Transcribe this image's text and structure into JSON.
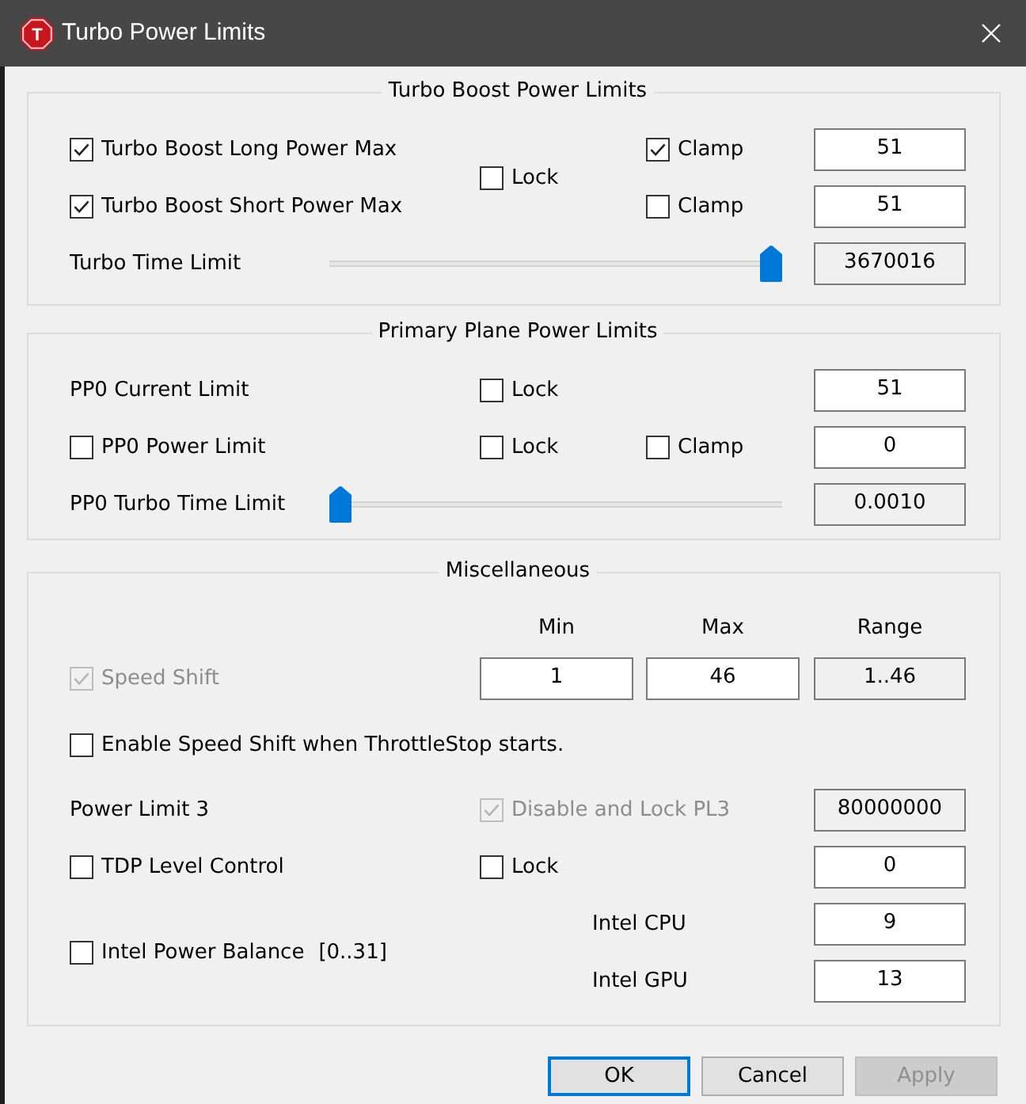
{
  "window": {
    "title": "Turbo Power Limits",
    "icon_label": "T"
  },
  "groups": [
    {
      "title": "Turbo Boost Power Limits",
      "rows": [
        {
          "kind": "pair",
          "lock": {
            "label": "Lock",
            "checked": false,
            "disabled": false
          },
          "lines": [
            {
              "check": {
                "label": "Turbo Boost Long Power Max",
                "checked": true,
                "disabled": false
              },
              "clamp": {
                "label": "Clamp",
                "checked": true,
                "disabled": false
              },
              "field": {
                "value": "51",
                "readonly": false
              }
            },
            {
              "check": {
                "label": "Turbo Boost Short Power Max",
                "checked": true,
                "disabled": false
              },
              "clamp": {
                "label": "Clamp",
                "checked": false,
                "disabled": false
              },
              "field": {
                "value": "51",
                "readonly": false
              }
            }
          ]
        },
        {
          "kind": "slider",
          "label": "Turbo Time Limit",
          "level": 1,
          "field": {
            "value": "3670016",
            "readonly": true
          }
        }
      ]
    },
    {
      "title": "Primary Plane Power Limits",
      "rows": [
        {
          "kind": "row",
          "label": "PP0 Current Limit",
          "lock": {
            "label": "Lock",
            "checked": false,
            "disabled": false
          },
          "field": {
            "value": "51",
            "readonly": false
          }
        },
        {
          "kind": "row",
          "check": {
            "label": "PP0 Power Limit",
            "checked": false,
            "disabled": false
          },
          "lock": {
            "label": "Lock",
            "checked": false,
            "disabled": false
          },
          "clamp": {
            "label": "Clamp",
            "checked": false,
            "disabled": false
          },
          "field": {
            "value": "0",
            "readonly": false
          }
        },
        {
          "kind": "slider",
          "label": "PP0 Turbo Time Limit",
          "level": 0,
          "field": {
            "value": "0.0010",
            "readonly": true
          }
        }
      ]
    },
    {
      "title": "Miscellaneous",
      "rows": [
        {
          "kind": "headers",
          "headers": [
            "Min",
            "Max",
            "Range"
          ]
        },
        {
          "kind": "range",
          "check": {
            "label": "Speed Shift",
            "checked": true,
            "disabled": true
          },
          "fields": [
            {
              "value": "1",
              "readonly": false
            },
            {
              "value": "46",
              "readonly": false
            },
            {
              "value": "1..46",
              "readonly": true
            }
          ]
        },
        {
          "kind": "row",
          "check": {
            "label": "Enable Speed Shift when ThrottleStop starts.",
            "checked": false,
            "disabled": false
          }
        },
        {
          "kind": "row",
          "label": "Power Limit 3",
          "lock": {
            "label": "Disable and Lock PL3",
            "checked": true,
            "disabled": true
          },
          "field": {
            "value": "80000000",
            "readonly": true
          }
        },
        {
          "kind": "row",
          "check": {
            "label": "TDP Level Control",
            "checked": false,
            "disabled": false
          },
          "lock": {
            "label": "Lock",
            "checked": false,
            "disabled": false
          },
          "field": {
            "value": "0",
            "readonly": false
          }
        },
        {
          "kind": "balance",
          "check": {
            "label": "Intel Power Balance",
            "checked": false,
            "disabled": false
          },
          "note": "[0..31]",
          "fields": [
            {
              "label": "Intel CPU",
              "value": "9",
              "readonly": false
            },
            {
              "label": "Intel GPU",
              "value": "13",
              "readonly": false
            }
          ]
        }
      ]
    }
  ],
  "buttons": [
    {
      "label": "OK",
      "focused": true,
      "disabled": false
    },
    {
      "label": "Cancel",
      "focused": false,
      "disabled": false
    },
    {
      "label": "Apply",
      "focused": false,
      "disabled": true
    }
  ]
}
